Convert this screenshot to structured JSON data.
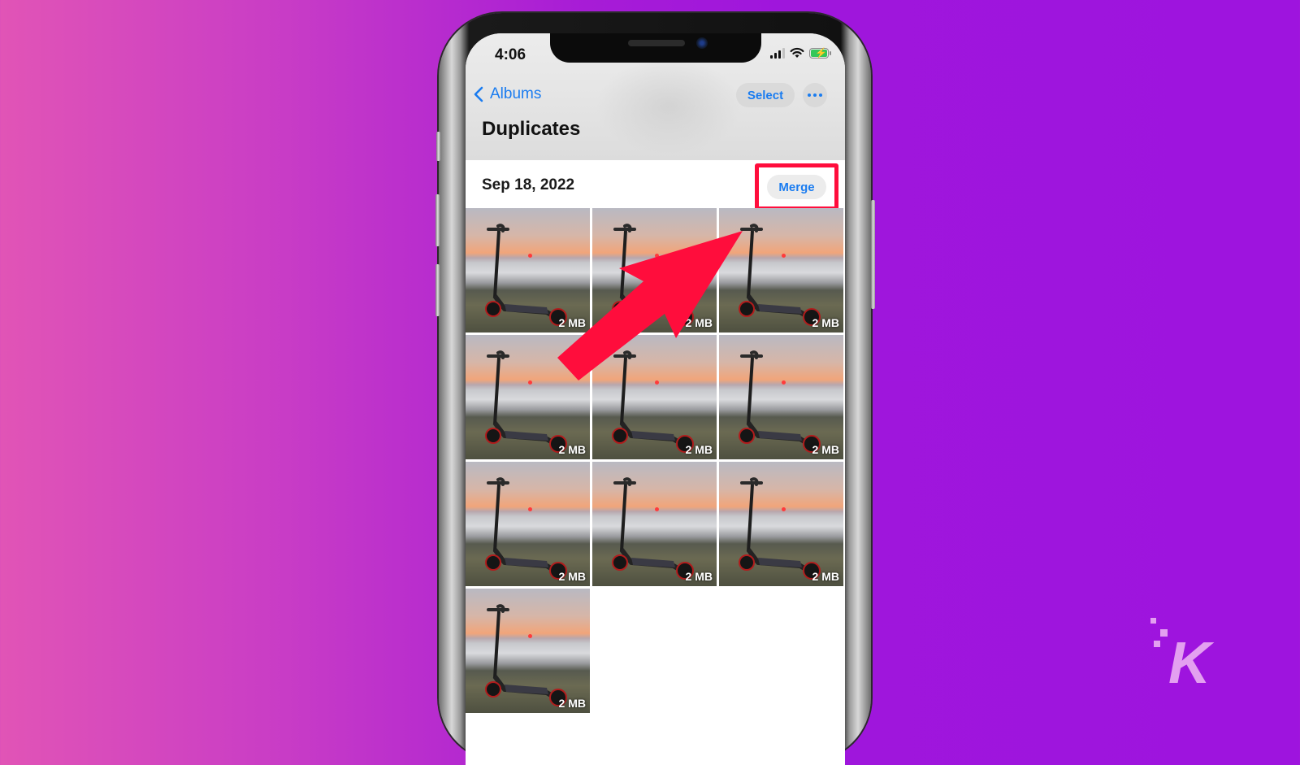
{
  "status_bar": {
    "time": "4:06",
    "signal_icon": "cellular-signal-icon",
    "wifi_icon": "wifi-icon",
    "battery_icon": "battery-charging-icon",
    "battery_color": "#34c759"
  },
  "nav": {
    "back_label": "Albums",
    "back_icon": "chevron-left-icon",
    "select_label": "Select",
    "more_icon": "ellipsis-icon",
    "title": "Duplicates",
    "accent_color": "#1a7cf0"
  },
  "section": {
    "date": "Sep 18, 2022",
    "merge_label": "Merge",
    "highlight_color": "#ff0d3c"
  },
  "photos": [
    {
      "size": "2 MB"
    },
    {
      "size": "2 MB"
    },
    {
      "size": "2 MB"
    },
    {
      "size": "2 MB"
    },
    {
      "size": "2 MB"
    },
    {
      "size": "2 MB"
    },
    {
      "size": "2 MB"
    },
    {
      "size": "2 MB"
    },
    {
      "size": "2 MB"
    },
    {
      "size": "2 MB"
    }
  ],
  "annotation": {
    "arrow_icon": "arrow-up-right-icon",
    "arrow_color": "#ff0d3c"
  },
  "branding": {
    "logo_letter": "K",
    "logo_color": "#e3a0f0"
  }
}
